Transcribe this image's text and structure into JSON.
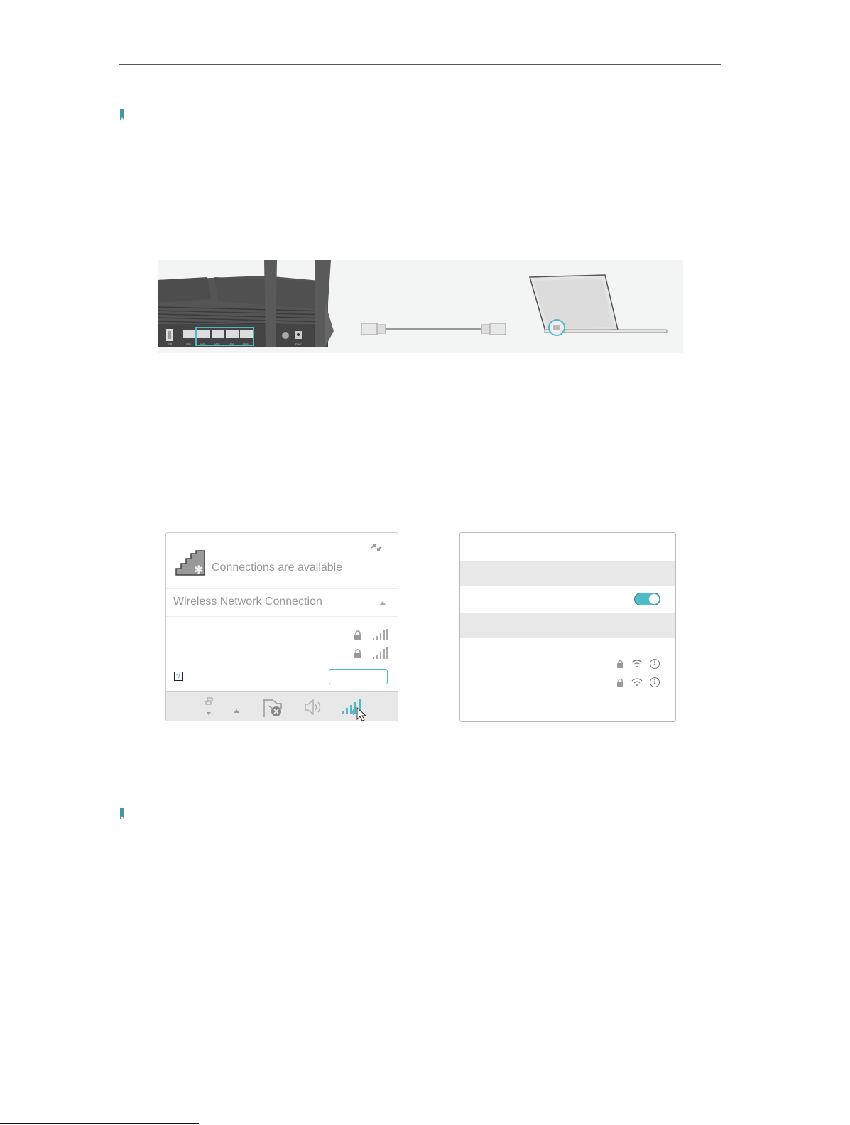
{
  "document": {
    "header_rule": true,
    "notes": [
      {
        "icon": "bookmark-icon",
        "text": ""
      },
      {
        "icon": "bookmark-icon",
        "text": ""
      }
    ]
  },
  "figure_wired": {
    "router_ports": [
      "USB",
      "WAN",
      "LAN1",
      "LAN2",
      "LAN3",
      "LAN4"
    ],
    "router_buttons": [
      "WPS",
      "Power"
    ],
    "highlighted_ports": [
      "LAN1",
      "LAN2",
      "LAN3",
      "LAN4"
    ],
    "highlight_color": "#4fb8c6",
    "cable": "ethernet-cable",
    "device": "laptop"
  },
  "windows_panel": {
    "status_text": "Connections are available",
    "section_title": "Wireless Network Connection",
    "networks": [
      {
        "secured": true,
        "signal": "full"
      },
      {
        "secured": true,
        "signal": "full"
      }
    ],
    "connect_automatically_checked": true,
    "connect_button_label": "",
    "taskbar_icons": [
      "show-desktop-icon",
      "show-hidden-icons-arrow",
      "action-center-flag-icon",
      "volume-icon",
      "wireless-network-icon"
    ],
    "accent": "#4fb8c6"
  },
  "mac_panel": {
    "wifi_toggle_on": true,
    "networks": [
      {
        "secured": true,
        "wifi": true,
        "info": "i"
      },
      {
        "secured": true,
        "wifi": true,
        "info": "i"
      }
    ],
    "toggle_color": "#4fbdc9"
  }
}
